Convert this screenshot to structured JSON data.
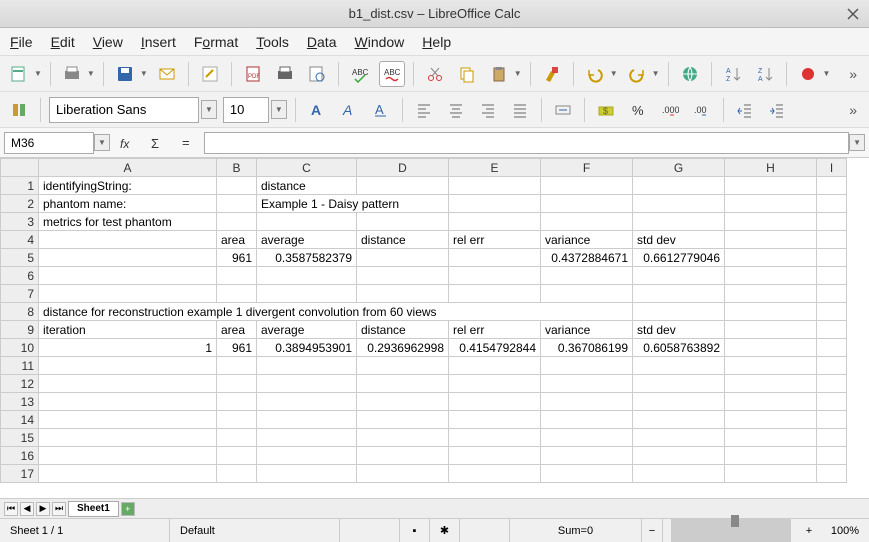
{
  "window": {
    "title": "b1_dist.csv – LibreOffice Calc"
  },
  "menu": {
    "file": "File",
    "edit": "Edit",
    "view": "View",
    "insert": "Insert",
    "format": "Format",
    "tools": "Tools",
    "data": "Data",
    "window": "Window",
    "help": "Help"
  },
  "font": {
    "name": "Liberation Sans",
    "size": "10"
  },
  "formula": {
    "cellref": "M36",
    "value": ""
  },
  "columns": [
    "A",
    "B",
    "C",
    "D",
    "E",
    "F",
    "G",
    "H",
    "I"
  ],
  "rows": [
    "1",
    "2",
    "3",
    "4",
    "5",
    "6",
    "7",
    "8",
    "9",
    "10",
    "11",
    "12",
    "13",
    "14",
    "15",
    "16",
    "17"
  ],
  "cells": {
    "r1": {
      "A": "identifyingString:",
      "C": "distance"
    },
    "r2": {
      "A": "phantom name:",
      "C": "Example 1 - Daisy pattern"
    },
    "r3": {
      "A": "metrics for test phantom"
    },
    "r4": {
      "B": "area",
      "C": "average",
      "D": "distance",
      "E": "rel err",
      "F": "variance",
      "G": "std dev"
    },
    "r5": {
      "B": "961",
      "C": "0.3587582379",
      "F": "0.4372884671",
      "G": "0.6612779046"
    },
    "r8": {
      "A": "distance for reconstruction example 1 divergent convolution from 60 views"
    },
    "r9": {
      "A": "iteration",
      "B": "area",
      "C": "average",
      "D": "distance",
      "E": "rel err",
      "F": "variance",
      "G": "std dev"
    },
    "r10": {
      "A": "1",
      "B": "961",
      "C": "0.3894953901",
      "D": "0.2936962998",
      "E": "0.4154792844",
      "F": "0.367086199",
      "G": "0.6058763892"
    }
  },
  "tabs": {
    "sheet1": "Sheet1"
  },
  "status": {
    "sheet": "Sheet 1 / 1",
    "style": "Default",
    "sum": "Sum=0",
    "zoom": "100%"
  },
  "chart_data": {
    "type": "table",
    "title": "b1_dist.csv",
    "sections": [
      {
        "header": "metrics for test phantom",
        "columns": [
          "area",
          "average",
          "distance",
          "rel err",
          "variance",
          "std dev"
        ],
        "rows": [
          {
            "area": 961,
            "average": 0.3587582379,
            "distance": null,
            "rel err": null,
            "variance": 0.4372884671,
            "std dev": 0.6612779046
          }
        ]
      },
      {
        "header": "distance for reconstruction example 1 divergent convolution from 60 views",
        "columns": [
          "iteration",
          "area",
          "average",
          "distance",
          "rel err",
          "variance",
          "std dev"
        ],
        "rows": [
          {
            "iteration": 1,
            "area": 961,
            "average": 0.3894953901,
            "distance": 0.2936962998,
            "rel err": 0.4154792844,
            "variance": 0.367086199,
            "std dev": 0.6058763892
          }
        ]
      }
    ],
    "meta": {
      "identifyingString": "distance",
      "phantom name": "Example 1 - Daisy pattern"
    }
  }
}
